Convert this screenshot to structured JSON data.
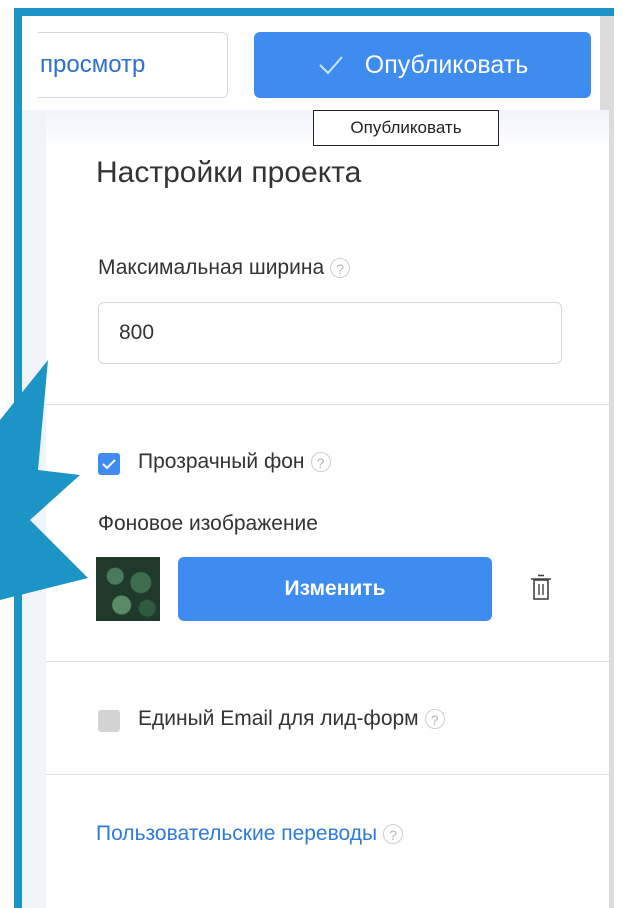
{
  "toolbar": {
    "preview_label": "просмотр",
    "publish_label": "Опубликовать",
    "tooltip": "Опубликовать"
  },
  "panel": {
    "title": "Настройки проекта",
    "max_width": {
      "label": "Максимальная ширина",
      "value": "800"
    },
    "transparent_bg": {
      "label": "Прозрачный фон",
      "checked": true
    },
    "bg_image": {
      "label": "Фоновое изображение",
      "change_label": "Изменить"
    },
    "single_email": {
      "label": "Единый Email для лид-форм",
      "checked": false
    },
    "custom_translations_link": "Пользовательские переводы",
    "help_glyph": "?"
  },
  "colors": {
    "accent": "#3f8cf0",
    "frame": "#1c94c6",
    "link": "#2f7bd8"
  }
}
